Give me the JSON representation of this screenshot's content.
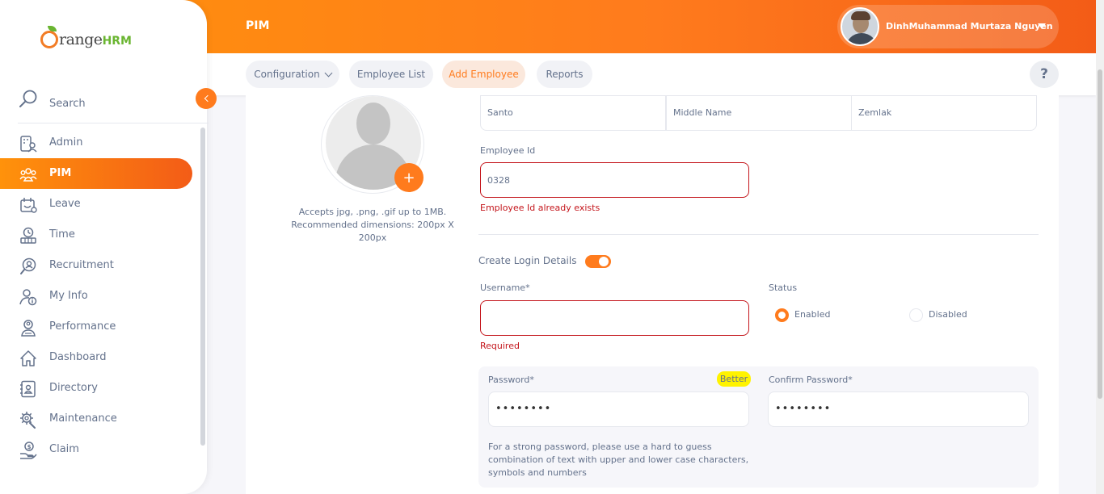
{
  "header": {
    "title": "PIM",
    "user_name": "DinhMuhammad Murtaza Nguyen"
  },
  "brand": {
    "logo_text": "OrangeHRM",
    "accent_color": "#ff7b1d",
    "error_color": "#c4161c"
  },
  "topnav": {
    "tabs": [
      {
        "label": "Configuration",
        "has_dropdown": true,
        "active": false
      },
      {
        "label": "Employee List",
        "active": false
      },
      {
        "label": "Add Employee",
        "active": true
      },
      {
        "label": "Reports",
        "active": false
      }
    ],
    "help_label": "?"
  },
  "sidebar": {
    "search_label": "Search",
    "items": [
      {
        "label": "Admin",
        "icon": "admin-icon"
      },
      {
        "label": "PIM",
        "icon": "pim-icon",
        "active": true
      },
      {
        "label": "Leave",
        "icon": "leave-icon"
      },
      {
        "label": "Time",
        "icon": "time-icon"
      },
      {
        "label": "Recruitment",
        "icon": "recruitment-icon"
      },
      {
        "label": "My Info",
        "icon": "my-info-icon"
      },
      {
        "label": "Performance",
        "icon": "performance-icon"
      },
      {
        "label": "Dashboard",
        "icon": "dashboard-icon"
      },
      {
        "label": "Directory",
        "icon": "directory-icon"
      },
      {
        "label": "Maintenance",
        "icon": "maintenance-icon"
      },
      {
        "label": "Claim",
        "icon": "claim-icon"
      }
    ]
  },
  "form": {
    "photo_hint": "Accepts jpg, .png, .gif up to 1MB. Recommended dimensions: 200px X 200px",
    "add_photo_label": "+",
    "first_name": "Santo",
    "middle_name_placeholder": "Middle Name",
    "last_name": "Zemlak",
    "employee_id_label": "Employee Id",
    "employee_id_value": "0328",
    "employee_id_error": "Employee Id already exists",
    "create_login_label": "Create Login Details",
    "create_login_enabled": true,
    "username_label": "Username*",
    "username_value": "",
    "username_error": "Required",
    "status_label": "Status",
    "status_options": [
      "Enabled",
      "Disabled"
    ],
    "status_selected": "Enabled",
    "password_label": "Password*",
    "password_strength": "Better",
    "password_value": "••••••••",
    "confirm_password_label": "Confirm Password*",
    "confirm_password_value": "••••••••",
    "password_hint": "For a strong password, please use a hard to guess combination of text with upper and lower case characters, symbols and numbers"
  }
}
